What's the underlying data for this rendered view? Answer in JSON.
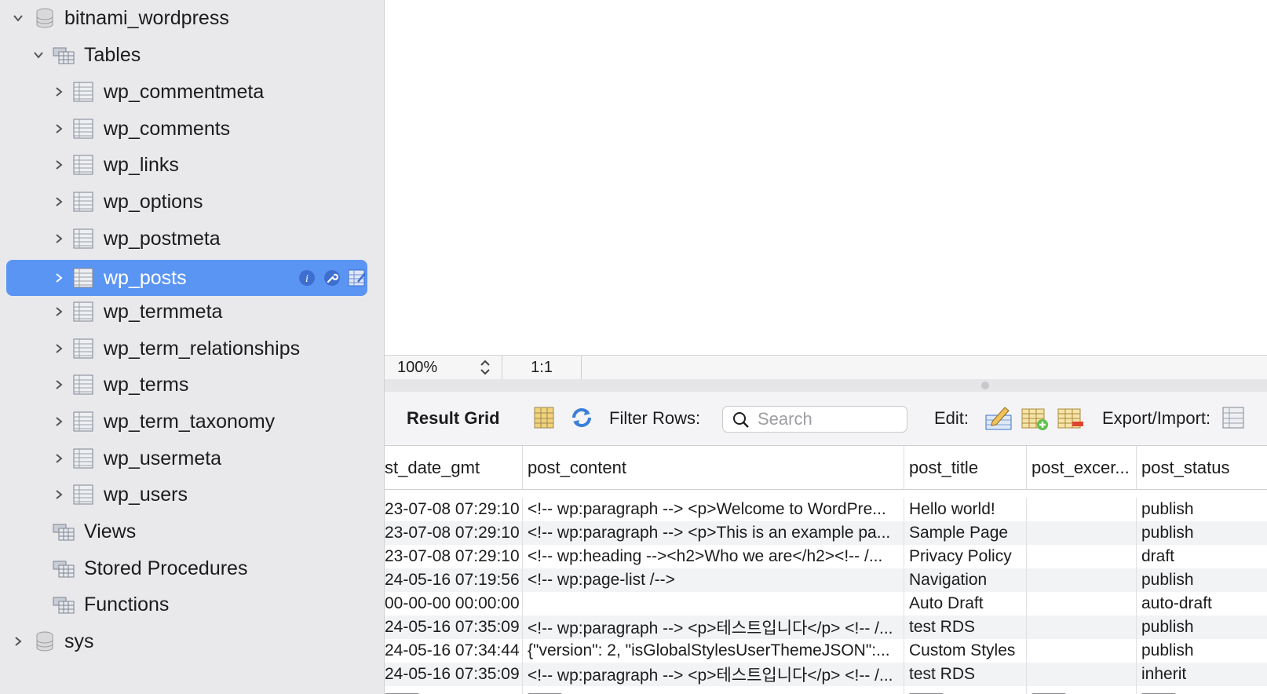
{
  "sidebar": {
    "schema": "bitnami_wordpress",
    "tables_group": "Tables",
    "tables": [
      "wp_commentmeta",
      "wp_comments",
      "wp_links",
      "wp_options",
      "wp_postmeta",
      "wp_posts",
      "wp_termmeta",
      "wp_term_relationships",
      "wp_terms",
      "wp_term_taxonomy",
      "wp_usermeta",
      "wp_users"
    ],
    "selected_table": "wp_posts",
    "views_group": "Views",
    "procedures_group": "Stored Procedures",
    "functions_group": "Functions",
    "other_schema": "sys",
    "colors": {
      "selected_bg": "#5b95f4",
      "sidebar_bg": "#e9e9ec"
    }
  },
  "editor": {
    "zoom": "100%",
    "cursor_position": "1:1"
  },
  "toolbar": {
    "result_grid_label": "Result Grid",
    "filter_rows_label": "Filter Rows:",
    "search_placeholder": "Search",
    "edit_label": "Edit:",
    "export_label": "Export/Import:"
  },
  "grid": {
    "columns": [
      "st_date_gmt",
      "post_content",
      "post_title",
      "post_excer...",
      "post_status"
    ],
    "rows": [
      [
        "23-07-08 07:29:10",
        "<!-- wp:paragraph --> <p>Welcome to WordPre...",
        "Hello world!",
        "",
        "publish"
      ],
      [
        "23-07-08 07:29:10",
        "<!-- wp:paragraph --> <p>This is an example pa...",
        "Sample Page",
        "",
        "publish"
      ],
      [
        "23-07-08 07:29:10",
        "<!-- wp:heading --><h2>Who we are</h2><!-- /...",
        "Privacy Policy",
        "",
        "draft"
      ],
      [
        "24-05-16 07:19:56",
        "<!-- wp:page-list /-->",
        "Navigation",
        "",
        "publish"
      ],
      [
        "00-00-00 00:00:00",
        "",
        "Auto Draft",
        "",
        "auto-draft"
      ],
      [
        "24-05-16 07:35:09",
        "<!-- wp:paragraph --> <p>테스트입니다</p> <!-- /...",
        "test RDS",
        "",
        "publish"
      ],
      [
        "24-05-16 07:34:44",
        "{\"version\": 2, \"isGlobalStylesUserThemeJSON\":...",
        "Custom Styles",
        "",
        "publish"
      ],
      [
        "24-05-16 07:35:09",
        "<!-- wp:paragraph --> <p>테스트입니다</p> <!-- /...",
        "test RDS",
        "",
        "inherit"
      ]
    ]
  }
}
